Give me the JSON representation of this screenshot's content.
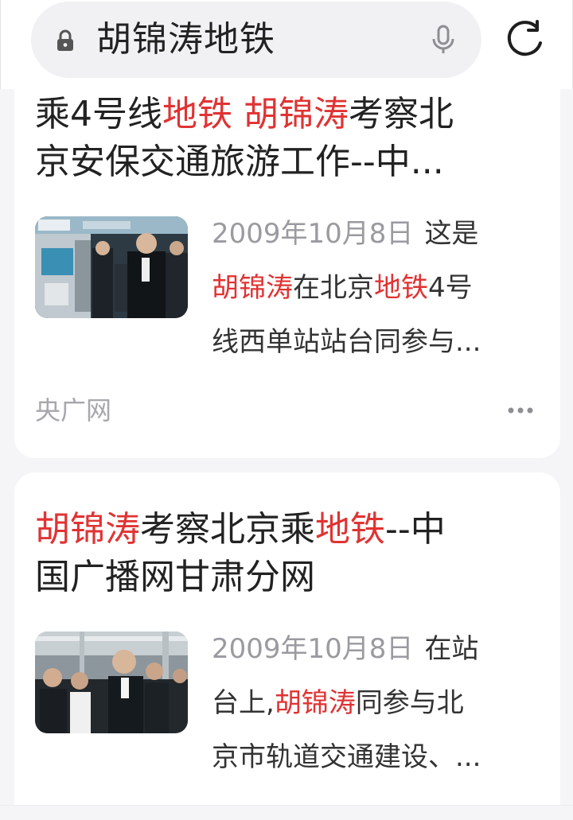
{
  "search": {
    "query": "胡锦涛地铁",
    "lock_icon": "lock-icon",
    "mic_icon": "mic-icon",
    "refresh_icon": "refresh-icon"
  },
  "highlight_color": "#e03333",
  "results": [
    {
      "title_lines": [
        [
          {
            "t": "乘4号线",
            "h": false
          },
          {
            "t": "地铁",
            "h": true
          },
          {
            "t": " ",
            "h": false
          },
          {
            "t": "胡锦涛",
            "h": true
          },
          {
            "t": "考察北",
            "h": false
          }
        ],
        [
          {
            "t": "京安保交通旅游工作--中...",
            "h": false
          }
        ]
      ],
      "date": "2009年10月8日",
      "snippet_lines": [
        [
          {
            "t": "这是",
            "h": false
          }
        ],
        [
          {
            "t": "胡锦涛",
            "h": true
          },
          {
            "t": "在北京",
            "h": false
          },
          {
            "t": "地铁",
            "h": true
          },
          {
            "t": "4号",
            "h": false
          }
        ],
        [
          {
            "t": "线西单站站台同参与...",
            "h": false
          }
        ]
      ],
      "source": "央广网",
      "thumbnail": "subway-station-photo"
    },
    {
      "title_lines": [
        [
          {
            "t": "胡锦涛",
            "h": true
          },
          {
            "t": "考察北京乘",
            "h": false
          },
          {
            "t": "地铁",
            "h": true
          },
          {
            "t": "--中",
            "h": false
          }
        ],
        [
          {
            "t": "国广播网甘肃分网",
            "h": false
          }
        ]
      ],
      "date": "2009年10月8日",
      "snippet_lines": [
        [
          {
            "t": "在站",
            "h": false
          }
        ],
        [
          {
            "t": "台上,",
            "h": false
          },
          {
            "t": "胡锦涛",
            "h": true
          },
          {
            "t": "同参与北",
            "h": false
          }
        ],
        [
          {
            "t": "京市轨道交通建设、...",
            "h": false
          }
        ]
      ],
      "thumbnail": "subway-car-photo"
    }
  ]
}
